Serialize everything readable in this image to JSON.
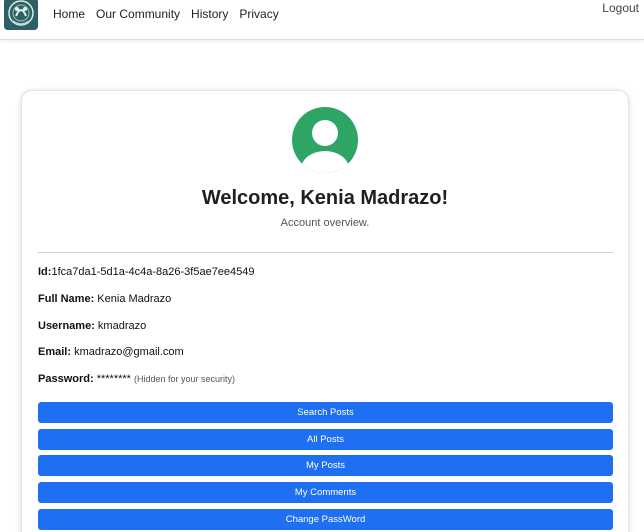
{
  "nav": {
    "links": [
      "Home",
      "Our Community",
      "History",
      "Privacy"
    ],
    "logout_label": "Logout"
  },
  "profile": {
    "welcome": "Welcome, Kenia Madrazo!",
    "subtitle": "Account overview.",
    "fields": {
      "id": {
        "label": "Id:",
        "value": "1fca7da1-5d1a-4c4a-8a26-3f5ae7ee4549"
      },
      "full_name": {
        "label": "Full Name:",
        "value": "Kenia Madrazo"
      },
      "username": {
        "label": "Username:",
        "value": "kmadrazo"
      },
      "email": {
        "label": "Email:",
        "value": "kmadrazo@gmail.com"
      },
      "password": {
        "label": "Password:",
        "value": "********",
        "hint": "(Hidden for your security)"
      }
    }
  },
  "actions": {
    "search_posts": "Search Posts",
    "all_posts": "All Posts",
    "my_posts": "My Posts",
    "my_comments": "My Comments",
    "change_password": "Change PassWord"
  },
  "colors": {
    "primary": "#1f6ff2",
    "avatar_green": "#2ea565",
    "logo_teal": "#2f5f66"
  },
  "icons": {
    "logo": "community-logo-icon",
    "avatar": "user-avatar-icon"
  }
}
